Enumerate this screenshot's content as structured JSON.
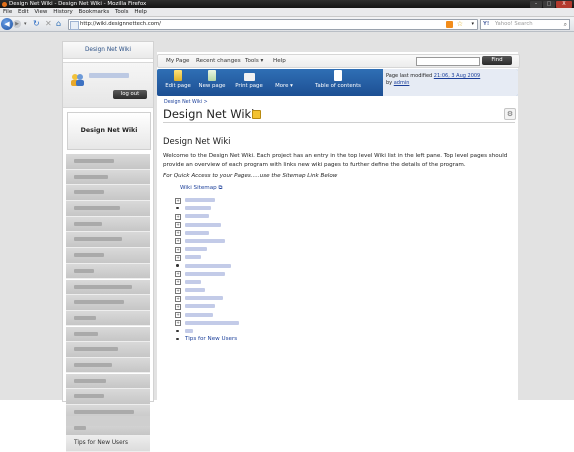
{
  "window": {
    "title": "Design Net Wiki - Design Net Wiki - Mozilla Firefox",
    "buttons": [
      "–",
      "□",
      "X"
    ]
  },
  "menubar": [
    "File",
    "Edit",
    "View",
    "History",
    "Bookmarks",
    "Tools",
    "Help"
  ],
  "browser": {
    "url": "http://wiki.designnettech.com/",
    "search_placeholder": "Yahoo! Search",
    "search_engine": "Y!"
  },
  "sidebar": {
    "title": "Design Net Wiki",
    "logout_label": "log out",
    "section_title": "Design Net Wiki",
    "items": [
      "",
      "",
      "",
      "",
      "",
      "",
      "",
      "",
      "",
      "",
      "",
      "",
      "",
      "",
      "",
      "",
      "",
      "",
      "",
      "",
      "",
      ""
    ],
    "tips_label": "Tips for New Users"
  },
  "topnav": {
    "links": [
      "My Page",
      "Recent changes",
      "Tools ▾",
      "Help"
    ],
    "find_label": "Find"
  },
  "toolbar": {
    "buttons": [
      "Edit page",
      "New page",
      "Print page",
      "More ▾",
      "Table of contents"
    ],
    "last_modified_prefix": "Page last modified ",
    "last_modified_date": "21:06, 3 Aug 2009",
    "by_prefix": "by ",
    "by_user": "admin"
  },
  "page": {
    "breadcrumb": "Design Net Wiki >",
    "title": "Design Net Wiki",
    "heading": "Design Net Wiki",
    "intro": "Welcome to the Design Net Wiki. Each project has an entry in the top level Wiki list in the left pane. Top level pages should provide an overview of each program with links new wiki pages to further define the details of the program.",
    "quick_access": "For Quick Access to your Pages.....use the Sitemap Link Below",
    "sitemap_label": "Wiki Sitemap",
    "tree_last": "Tips for New Users"
  }
}
